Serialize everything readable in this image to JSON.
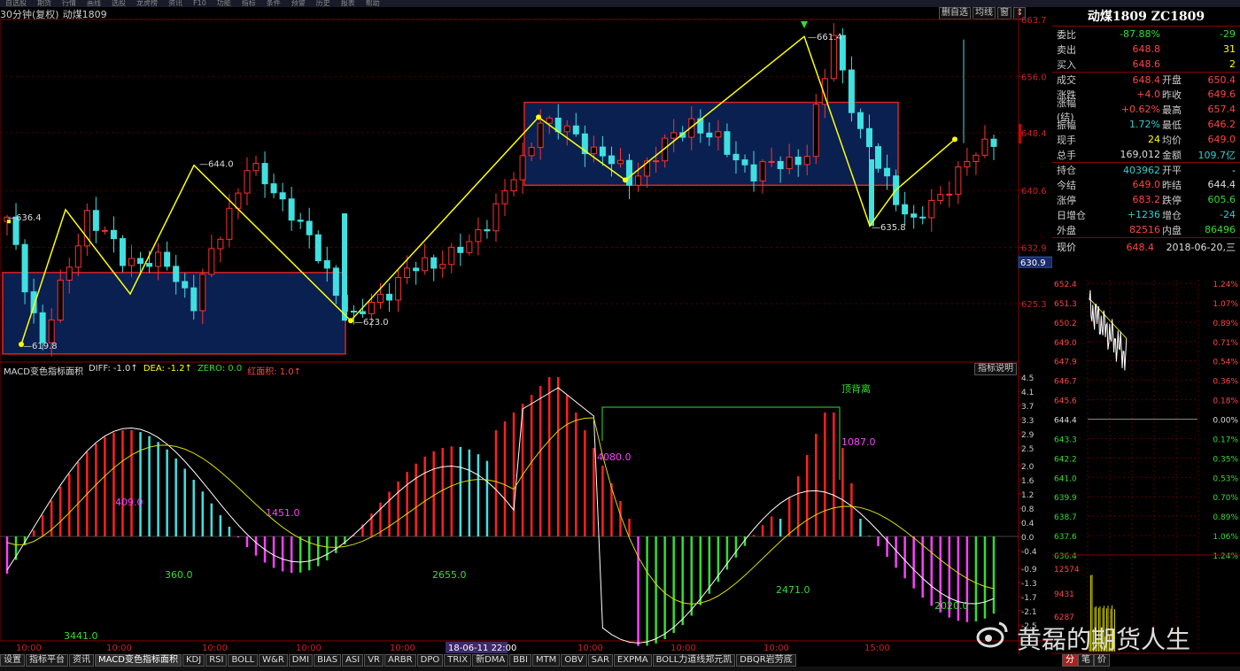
{
  "menu": [
    "自选股",
    "期货",
    "行情",
    "画线",
    "选股",
    "龙虎榜",
    "资讯",
    "F10",
    "功能",
    "指标",
    "条件",
    "预警",
    "历史",
    "报表",
    "帮助"
  ],
  "chart_header": {
    "period": "30分钟(复权)",
    "name": "动煤1809"
  },
  "main_tools": [
    "删自选",
    "均线",
    "窗",
    "↕"
  ],
  "main_chart": {
    "price_axis": [
      "663.7",
      "656.0",
      "648.4",
      "640.6",
      "632.9",
      "625.3"
    ],
    "current_price_tag": "630.9",
    "annotations": [
      {
        "label": "636.4"
      },
      {
        "label": "644.0"
      },
      {
        "label": "619.8"
      },
      {
        "label": "623.0"
      },
      {
        "label": "661.4"
      },
      {
        "label": "635.8"
      }
    ]
  },
  "macd": {
    "title": "MACD变色指标面积",
    "diff": "DIFF: -1.0↑",
    "dea": "DEA: -1.2↑",
    "zero": "ZERO: 0.0",
    "red_area": "红面积: 1.0↑",
    "btn": "指标说明",
    "axis": [
      "4.5",
      "4.1",
      "3.7",
      "3.3",
      "2.9",
      "2.5",
      "2.0",
      "1.6",
      "1.2",
      "0.8",
      "0.4",
      "0.0",
      "-0.4",
      "-0.9",
      "-1.3",
      "-1.7",
      "-2.1",
      "-2.5"
    ],
    "labels": [
      {
        "t": "409.0",
        "c": "mag"
      },
      {
        "t": "360.0",
        "c": "green"
      },
      {
        "t": "1451.0",
        "c": "mag"
      },
      {
        "t": "3441.0",
        "c": "green"
      },
      {
        "t": "2655.0",
        "c": "green"
      },
      {
        "t": "4080.0",
        "c": "mag"
      },
      {
        "t": "1087.0",
        "c": "mag"
      },
      {
        "t": "2471.0",
        "c": "green"
      },
      {
        "t": "2020.0",
        "c": "green"
      }
    ],
    "divergence": "顶背离"
  },
  "time_axis": [
    "10:00",
    "10:00",
    "10:00",
    "10:00",
    "10:00",
    "18-06-11 22:00",
    "10:00",
    "10:00",
    "10:00",
    "15:00"
  ],
  "tabs": [
    "设置",
    "指标平台",
    "资讯",
    "MACD变色指标面积",
    "KDJ",
    "RSI",
    "BOLL",
    "W&R",
    "DMI",
    "BIAS",
    "ASI",
    "VR",
    "ARBR",
    "DPO",
    "TRIX",
    "新DMA",
    "BBI",
    "MTM",
    "OBV",
    "SAR",
    "EXPMA",
    "BOLL力道线郑元凯",
    "DBQR岩劳底"
  ],
  "active_tab": "MACD变色指标面积",
  "right_tabs": [
    "分",
    "笔",
    "价"
  ],
  "quote": {
    "title": "动煤1809 ZC1809",
    "rows": [
      {
        "l": "委比",
        "v1": "-87.88%",
        "c1": "green",
        "l2": "",
        "v2": "-29",
        "c2": "green"
      },
      {
        "l": "卖出",
        "v1": "648.8",
        "c1": "red",
        "l2": "",
        "v2": "31",
        "c2": "yellow"
      },
      {
        "l": "买入",
        "v1": "648.6",
        "c1": "red",
        "l2": "",
        "v2": "2",
        "c2": "yellow"
      },
      {
        "l": "成交",
        "v1": "648.4",
        "c1": "red",
        "l2": "开盘",
        "v2": "650.4",
        "c2": "red"
      },
      {
        "l": "涨跌",
        "v1": "+4.0",
        "c1": "red",
        "l2": "昨收",
        "v2": "649.6",
        "c2": "red"
      },
      {
        "l": "涨幅(结)",
        "v1": "+0.62%",
        "c1": "red",
        "l2": "最高",
        "v2": "657.4",
        "c2": "red"
      },
      {
        "l": "振幅",
        "v1": "1.72%",
        "c1": "cyan",
        "l2": "最低",
        "v2": "646.2",
        "c2": "red"
      },
      {
        "l": "现手",
        "v1": "24",
        "c1": "yellow",
        "l2": "均价",
        "v2": "649.0",
        "c2": "red"
      },
      {
        "l": "总手",
        "v1": "169,012",
        "c1": "white",
        "l2": "金额",
        "v2": "109.7亿",
        "c2": "cyan"
      },
      {
        "l": "持仓",
        "v1": "403962",
        "c1": "cyan",
        "l2": "开平",
        "v2": "-",
        "c2": "white"
      },
      {
        "l": "今结",
        "v1": "649.0",
        "c1": "red",
        "l2": "昨结",
        "v2": "644.4",
        "c2": "white"
      },
      {
        "l": "涨停",
        "v1": "683.2",
        "c1": "red",
        "l2": "跌停",
        "v2": "605.6",
        "c2": "green"
      },
      {
        "l": "日增仓",
        "v1": "+1236",
        "c1": "cyan",
        "l2": "增仓",
        "v2": "-24",
        "c2": "cyan"
      },
      {
        "l": "外盘",
        "v1": "82516",
        "c1": "red",
        "l2": "内盘",
        "v2": "86496",
        "c2": "green"
      }
    ],
    "xianjia_label": "现价",
    "xianjia_val": "648.4",
    "date": "2018-06-20,三",
    "mini_left": [
      "652.4",
      "651.3",
      "650.2",
      "649.0",
      "647.9",
      "646.7",
      "645.6",
      "644.4",
      "643.3",
      "642.2",
      "641.0",
      "639.9",
      "638.7",
      "637.6",
      "636.4"
    ],
    "mini_right": [
      "1.24%",
      "1.07%",
      "0.89%",
      "0.71%",
      "0.54%",
      "0.36%",
      "0.18%",
      "0.00%",
      "0.17%",
      "0.35%",
      "0.53%",
      "0.70%",
      "0.89%",
      "1.06%",
      "1.24%"
    ],
    "vol_axis": [
      "12574",
      "9431",
      "6287"
    ]
  },
  "watermark": "黄磊的期货人生"
}
